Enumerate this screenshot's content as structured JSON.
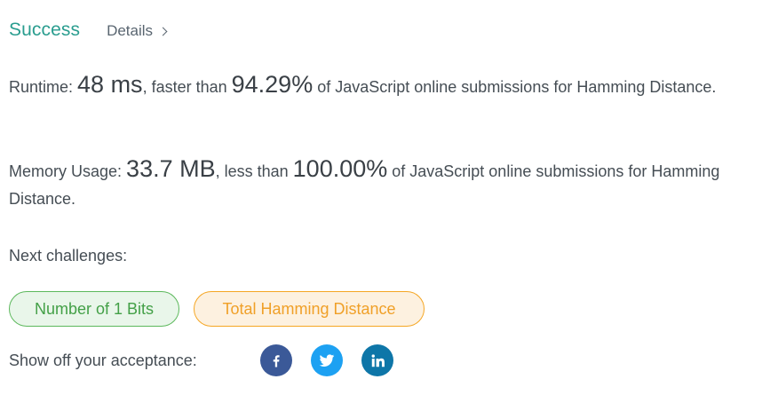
{
  "header": {
    "status": "Success",
    "details_label": "Details"
  },
  "runtime": {
    "label": "Runtime: ",
    "value": "48 ms",
    "comparison": ", faster than ",
    "percent": "94.29%",
    "suffix": " of JavaScript online submissions for Hamming Distance."
  },
  "memory": {
    "label": "Memory Usage: ",
    "value": "33.7 MB",
    "comparison": ", less than ",
    "percent": "100.00%",
    "suffix": " of JavaScript online submissions for Hamming Distance."
  },
  "next": {
    "label": "Next challenges:",
    "challenges": [
      {
        "title": "Number of 1 Bits",
        "difficulty": "easy",
        "color": "#43a047"
      },
      {
        "title": "Total Hamming Distance",
        "difficulty": "medium",
        "color": "#f0a028"
      }
    ]
  },
  "share": {
    "label": "Show off your acceptance:",
    "networks": [
      {
        "icon": "facebook-icon",
        "color": "#3b5998"
      },
      {
        "icon": "twitter-icon",
        "color": "#1da1f2"
      },
      {
        "icon": "linkedin-icon",
        "color": "#0e76a8"
      }
    ]
  }
}
